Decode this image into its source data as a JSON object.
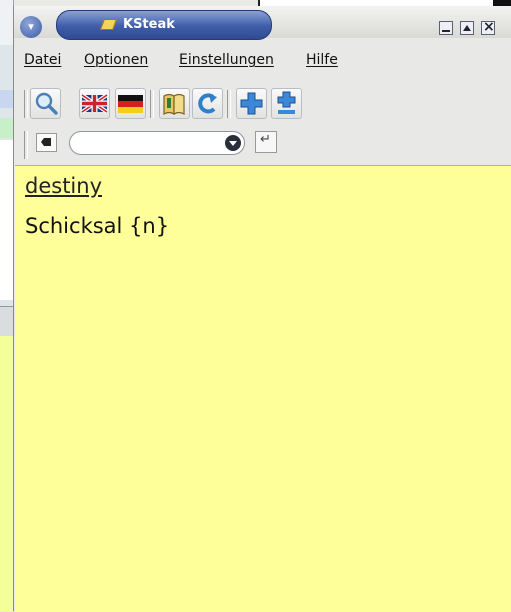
{
  "window": {
    "title": "KSteak"
  },
  "menubar": {
    "items": [
      {
        "label": "Datei"
      },
      {
        "label": "Optionen"
      },
      {
        "label": "Einstellungen"
      },
      {
        "label": "Hilfe"
      }
    ]
  },
  "toolbar": {
    "buttons": [
      {
        "icon": "search-icon"
      },
      {
        "icon": "uk-flag-icon"
      },
      {
        "icon": "german-flag-icon"
      },
      {
        "icon": "book-icon"
      },
      {
        "icon": "arrow-return-icon"
      },
      {
        "icon": "add-icon"
      },
      {
        "icon": "add-entry-icon"
      }
    ]
  },
  "search": {
    "value": "",
    "placeholder": ""
  },
  "result": {
    "word": "destiny",
    "translation": "Schicksal {n}"
  },
  "colors": {
    "result_background": "#ffff99",
    "title_pill": "#3f5da8"
  }
}
